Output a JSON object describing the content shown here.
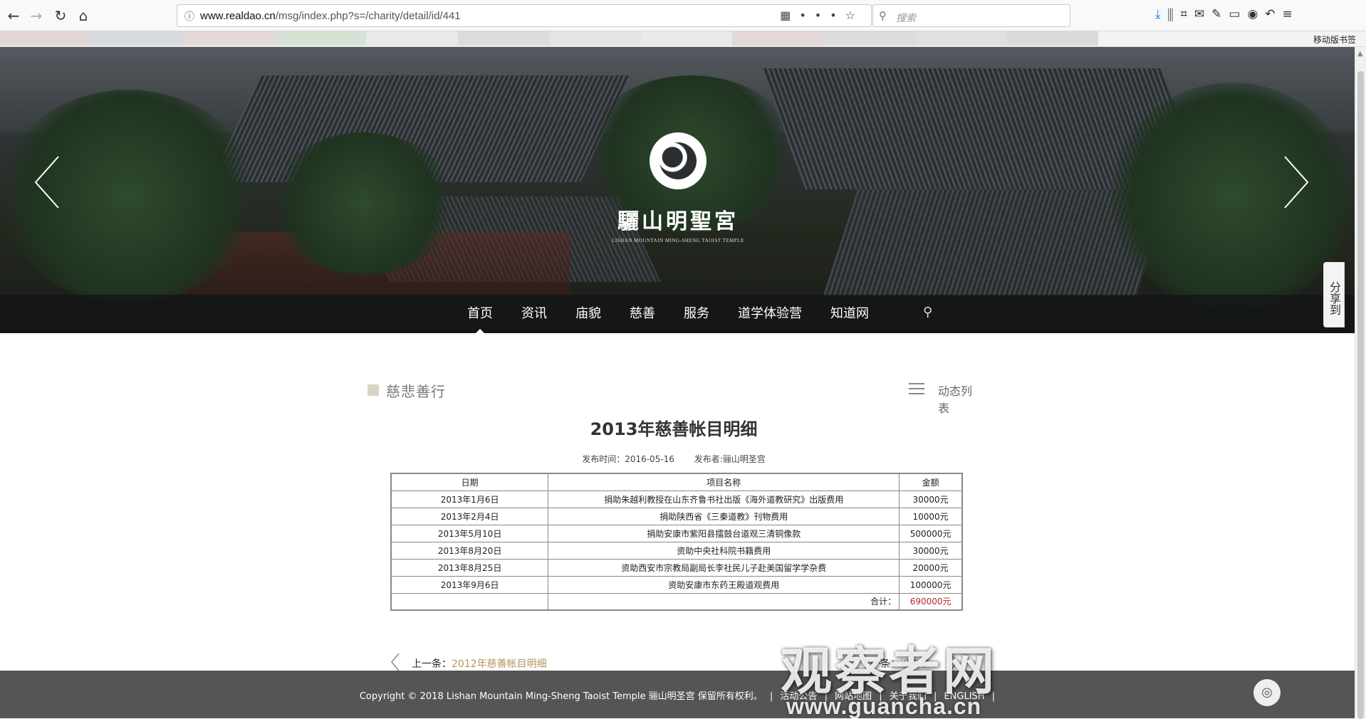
{
  "browser": {
    "url_prefix": "www.realdao.cn",
    "url_path": "/msg/index.php?s=/charity/detail/id/441",
    "search_placeholder": "搜索",
    "mobile_bookmarks": "移动版书签"
  },
  "bookmark_colors": [
    "#e2d6d6",
    "#d7dbe0",
    "#e3d9d9",
    "#d6e3d4",
    "#e9e9e9",
    "#dcdcdc",
    "#e4e4e4",
    "#e9e9e9",
    "#e2d8d8",
    "#dcdcdc",
    "#e0e0e0",
    "#dadada"
  ],
  "site": {
    "logo_name": "驪山明聖宮",
    "logo_sub": "LISHAN MOUNTAIN MING-SHENG TAOIST TEMPLE"
  },
  "nav": {
    "items": [
      "首页",
      "资讯",
      "庙貌",
      "慈善",
      "服务",
      "道学体验营",
      "知道网"
    ],
    "active_index": 0,
    "search_icon": "search-icon"
  },
  "share": {
    "label": "分享到"
  },
  "section": {
    "title": "慈悲善行",
    "list_label": "动态列表"
  },
  "article": {
    "title": "2013年慈善帐目明细",
    "publish_time": "发布时间：2016-05-16",
    "publisher": "发布者:骊山明圣宫"
  },
  "table": {
    "headers": [
      "日期",
      "项目名称",
      "金额"
    ],
    "rows": [
      [
        "2013年1月6日",
        "捐助朱越利教授在山东齐鲁书社出版《海外道教研究》出版费用",
        "30000元"
      ],
      [
        "2013年2月4日",
        "捐助陕西省《三秦道教》刊物费用",
        "10000元"
      ],
      [
        "2013年5月10日",
        "捐助安康市紫阳县擂鼓台道观三清铜像款",
        "500000元"
      ],
      [
        "2013年8月20日",
        "资助中央社科院书籍费用",
        "30000元"
      ],
      [
        "2013年8月25日",
        "资助西安市宗教局副局长李社民儿子赴美国留学学杂费",
        "20000元"
      ],
      [
        "2013年9月6日",
        "资助安康市东药王殿道观费用",
        "100000元"
      ]
    ],
    "total_label": "合计：",
    "total_value": "690000元"
  },
  "pager": {
    "prev_label": "上一条：",
    "prev_title": "2012年慈善帐目明细",
    "next_label": "下一条：",
    "next_title": "没有了"
  },
  "footer": {
    "copyright": "Copyright © 2018 Lishan Mountain Ming-Sheng Taoist Temple 骊山明圣宫 保留所有权利。",
    "links": [
      "活动公告",
      "网站地图",
      "关于我们",
      "ENGLISH"
    ]
  },
  "watermark": {
    "big": "观察者网",
    "small": "www.guancha.cn"
  }
}
